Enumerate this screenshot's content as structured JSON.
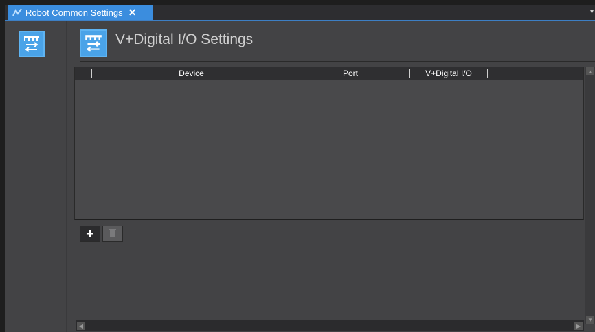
{
  "tab": {
    "title": "Robot Common Settings",
    "close_glyph": "✕",
    "overflow_glyph": "▾",
    "icon": "robot-settings-icon"
  },
  "sidebar": {
    "icon": "io-settings-icon"
  },
  "header": {
    "title": "V+Digital I/O Settings",
    "icon": "io-settings-icon"
  },
  "grid": {
    "columns": [
      "Device",
      "Port",
      "V+Digital I/O"
    ],
    "rows": []
  },
  "toolbar": {
    "add_glyph": "+",
    "add_icon": "plus-icon",
    "delete_icon": "trash-icon"
  },
  "colors": {
    "accent": "#3b8dde",
    "panel": "#434345",
    "grid_header": "#2f2f31"
  }
}
